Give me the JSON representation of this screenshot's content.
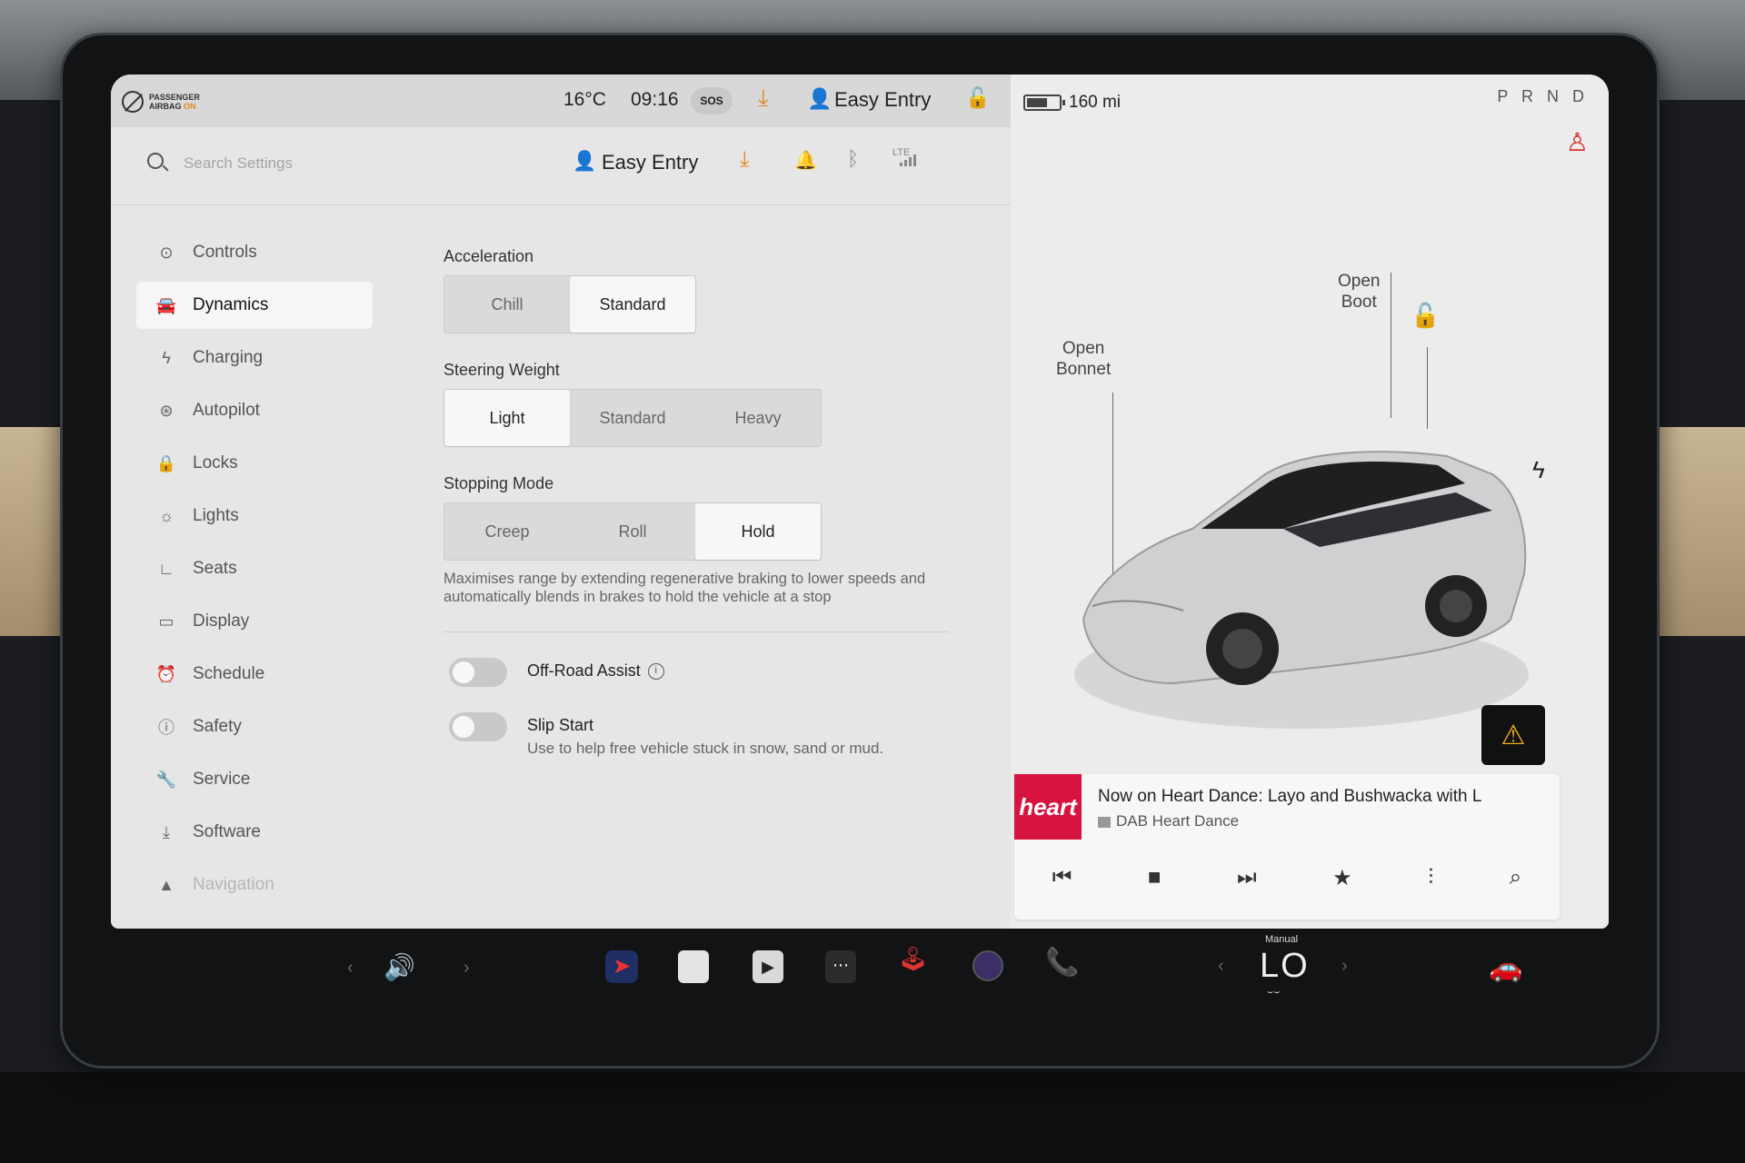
{
  "status_bar": {
    "airbag_line1": "PASSENGER",
    "airbag_line2": "AIRBAG",
    "airbag_state": "ON",
    "temperature": "16°C",
    "time": "09:16",
    "sos": "SOS",
    "profile": "Easy Entry"
  },
  "header": {
    "search_placeholder": "Search Settings",
    "profile": "Easy Entry",
    "lte": "LTE"
  },
  "sidebar": {
    "items": [
      {
        "label": "Controls",
        "icon": "toggle-icon"
      },
      {
        "label": "Dynamics",
        "icon": "car-icon"
      },
      {
        "label": "Charging",
        "icon": "bolt-icon"
      },
      {
        "label": "Autopilot",
        "icon": "steering-wheel-icon"
      },
      {
        "label": "Locks",
        "icon": "lock-icon"
      },
      {
        "label": "Lights",
        "icon": "light-icon"
      },
      {
        "label": "Seats",
        "icon": "seat-icon"
      },
      {
        "label": "Display",
        "icon": "display-icon"
      },
      {
        "label": "Schedule",
        "icon": "alarm-clock-icon"
      },
      {
        "label": "Safety",
        "icon": "safety-icon"
      },
      {
        "label": "Service",
        "icon": "wrench-icon"
      },
      {
        "label": "Software",
        "icon": "download-icon"
      },
      {
        "label": "Navigation",
        "icon": "navigation-icon"
      }
    ],
    "active": "Dynamics"
  },
  "settings": {
    "acceleration": {
      "title": "Acceleration",
      "options": [
        "Chill",
        "Standard"
      ],
      "selected": "Standard"
    },
    "steering_weight": {
      "title": "Steering Weight",
      "options": [
        "Light",
        "Standard",
        "Heavy"
      ],
      "selected": "Light"
    },
    "stopping_mode": {
      "title": "Stopping Mode",
      "options": [
        "Creep",
        "Roll",
        "Hold"
      ],
      "selected": "Hold",
      "description": "Maximises range by extending regenerative braking to lower speeds and automatically blends in brakes to hold the vehicle at a stop"
    },
    "off_road_assist": {
      "label": "Off-Road Assist",
      "enabled": false
    },
    "slip_start": {
      "label": "Slip Start",
      "description": "Use to help free vehicle stuck in snow, sand or mud.",
      "enabled": false
    }
  },
  "vehicle": {
    "range": "160 mi",
    "gears": "P R N D",
    "open_bonnet_line1": "Open",
    "open_bonnet_line2": "Bonnet",
    "open_boot_line1": "Open",
    "open_boot_line2": "Boot"
  },
  "media": {
    "logo": "heart",
    "title": "Now on Heart Dance: Layo and Bushwacka with L",
    "station": "DAB Heart Dance"
  },
  "dock": {
    "climate_mode": "Manual",
    "climate_temp": "LO"
  },
  "colors": {
    "accent_orange": "#e08a1f",
    "warning_red": "#d9342b",
    "heart_red": "#d6143f",
    "phone_green": "#24c24e"
  }
}
